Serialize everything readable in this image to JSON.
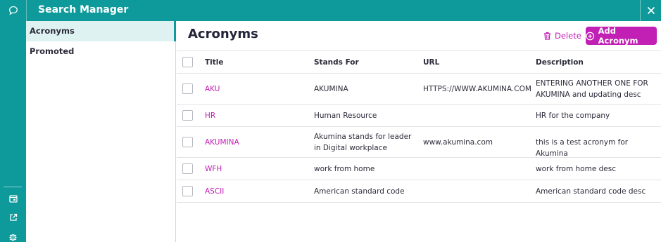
{
  "app": {
    "title": "Search Manager"
  },
  "sidebar": {
    "items": [
      {
        "label": "Acronyms",
        "active": true
      },
      {
        "label": "Promoted",
        "active": false
      }
    ]
  },
  "main": {
    "title": "Acronyms",
    "delete_label": "Delete",
    "add_label": "Add Acronym"
  },
  "table": {
    "columns": [
      "Title",
      "Stands For",
      "URL",
      "Description"
    ],
    "rows": [
      {
        "title": "AKU",
        "stands_for": "AKUMINA",
        "url": "HTTPS://WWW.AKUMINA.COM",
        "description": "ENTERING ANOTHER ONE FOR AKUMINA and updating desc"
      },
      {
        "title": "HR",
        "stands_for": "Human Resource",
        "url": "",
        "description": "HR for the company"
      },
      {
        "title": "AKUMINA",
        "stands_for": "Akumina stands for leader in Digital workplace",
        "url": "www.akumina.com",
        "description": "this is a test acronym for Akumina"
      },
      {
        "title": "WFH",
        "stands_for": "work from home",
        "url": "",
        "description": "work from home desc"
      },
      {
        "title": "ASCII",
        "stands_for": "American standard code",
        "url": "",
        "description": "American standard code desc"
      }
    ]
  },
  "colors": {
    "teal": "#0e9a9a",
    "accent": "#c21fb4"
  },
  "icons": [
    "chat-bubble-icon",
    "close-icon",
    "calendar-icon",
    "external-link-icon",
    "bug-icon",
    "trash-icon",
    "plus-circle-icon"
  ]
}
